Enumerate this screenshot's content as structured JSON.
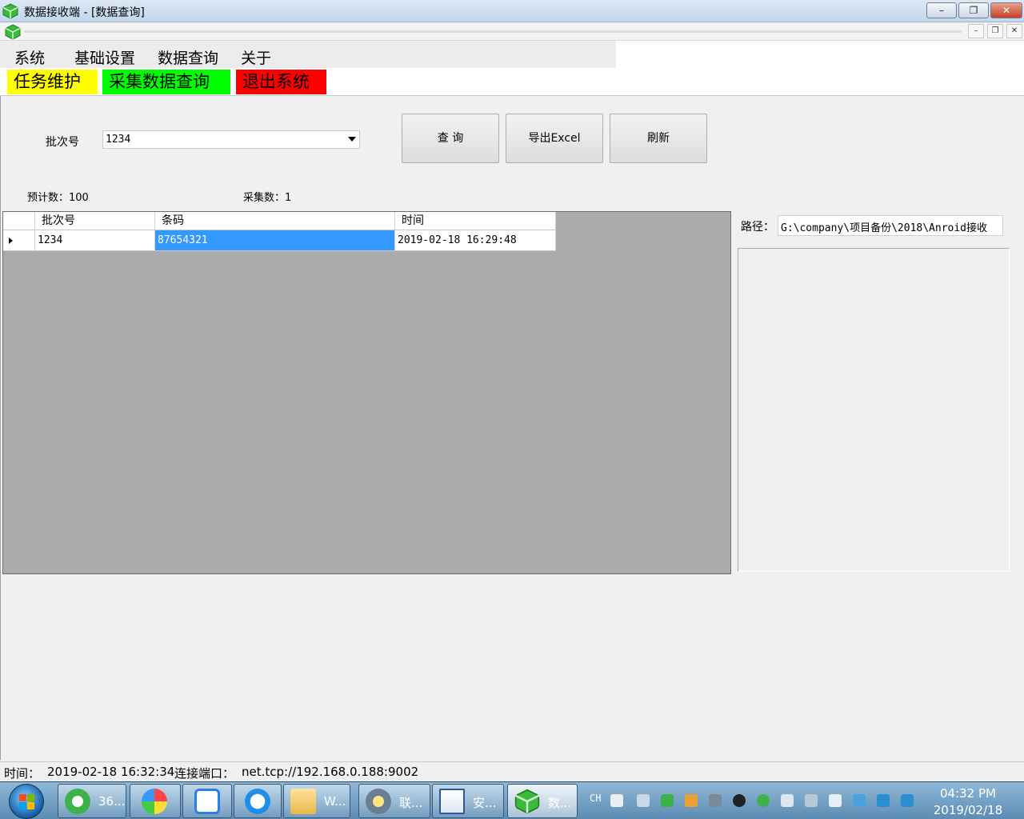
{
  "window": {
    "title": "数据接收端 - [数据查询]",
    "controls": {
      "minimize": "–",
      "maximize": "❐",
      "close": "✕"
    },
    "mdi_controls": {
      "minimize": "–",
      "restore": "❐",
      "close": "✕"
    }
  },
  "menu": {
    "items": [
      {
        "label": "系统"
      },
      {
        "label": "基础设置"
      },
      {
        "label": "数据查询"
      },
      {
        "label": "关于"
      }
    ]
  },
  "toolbar": {
    "task": {
      "label": "任务维护",
      "color": "#ffff00"
    },
    "query": {
      "label": "采集数据查询",
      "color": "#00ff00"
    },
    "exit": {
      "label": "退出系统",
      "color": "#ff0000"
    }
  },
  "form": {
    "batch_label": "批次号",
    "batch_value": "1234",
    "buttons": {
      "query": "查 询",
      "export": "导出Excel",
      "refresh": "刷新"
    },
    "expected": "预计数：100",
    "collected": "采集数：1"
  },
  "grid": {
    "columns": [
      "批次号",
      "条码",
      "时间"
    ],
    "rows": [
      [
        "1234",
        "87654321",
        "2019-02-18 16:29:48"
      ]
    ],
    "selection_color": "#3399ff"
  },
  "path": {
    "label": "路径：",
    "value": "G:\\company\\项目备份\\2018\\Anroid接收"
  },
  "status": {
    "time_label": "时间：",
    "time_value": "2019-02-18 16:32:34",
    "port_label": "连接端口：",
    "port_value": "net.tcp://192.168.0.188:9002"
  },
  "taskbar": {
    "tasks": [
      {
        "label": "36...",
        "icon": "ie-360-icon"
      },
      {
        "label": "",
        "icon": "pinwheel-icon"
      },
      {
        "label": "",
        "icon": "baidu-cloud-icon"
      },
      {
        "label": "",
        "icon": "qq-browser-icon"
      },
      {
        "label": "W...",
        "icon": "folder-icon"
      },
      {
        "label": "联...",
        "icon": "star-app-icon"
      },
      {
        "label": "安...",
        "icon": "word-doc-icon"
      },
      {
        "label": "数...",
        "icon": "data-receiver-icon"
      }
    ],
    "lang": "CH",
    "time": "04:32 PM",
    "date": "2019/02/18"
  }
}
